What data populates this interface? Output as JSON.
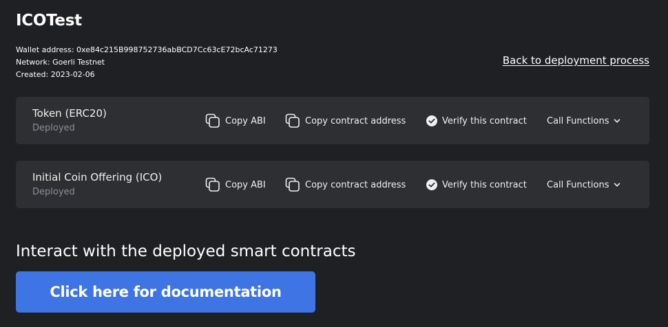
{
  "page": {
    "title": "ICOTest",
    "wallet_address": "Wallet address: 0xe84c215B998752736abBCD7Cc63cE72bcAc71273",
    "network": "Network: Goerli Testnet",
    "created": "Created: 2023-02-06",
    "back_link": "Back to deployment process"
  },
  "contracts": [
    {
      "name": "Token (ERC20)",
      "status": "Deployed",
      "copy_abi": "Copy ABI",
      "copy_address": "Copy contract address",
      "verify": "Verify this contract",
      "call_functions": "Call Functions"
    },
    {
      "name": "Initial Coin Offering (ICO)",
      "status": "Deployed",
      "copy_abi": "Copy ABI",
      "copy_address": "Copy contract address",
      "verify": "Verify this contract",
      "call_functions": "Call Functions"
    }
  ],
  "interact": {
    "heading": "Interact with the deployed smart contracts",
    "button_label": "Click here for documentation"
  },
  "icons": {
    "copy": "copy-icon",
    "verify": "check-circle-icon",
    "dropdown": "chevron-down-icon"
  },
  "colors": {
    "background": "#1f2023",
    "card": "#2d2f33",
    "status_text": "#8b8f97",
    "primary_button": "#3e74e3"
  }
}
